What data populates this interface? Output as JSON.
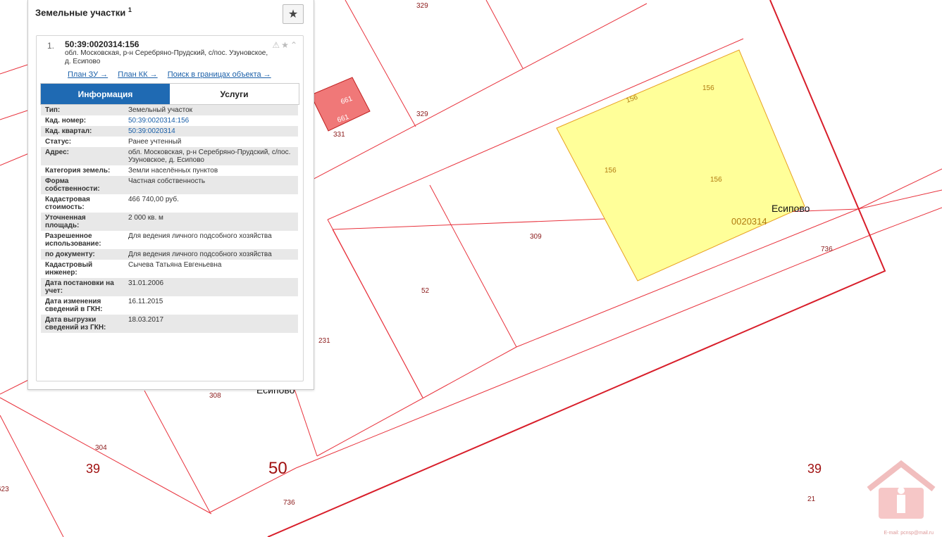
{
  "map": {
    "labels": {
      "l329a": "329",
      "l329b": "329",
      "l661a": "661",
      "l661b": "661",
      "l331": "331",
      "l156a": "156",
      "l156b": "156",
      "l156c": "156",
      "l156d": "156",
      "l309": "309",
      "l52": "52",
      "l231": "231",
      "l308": "308",
      "l304": "304",
      "l736a": "736",
      "l736b": "736",
      "l21": "21",
      "l623": "623",
      "l39a": "39",
      "l39b": "39",
      "l50": "50",
      "quarter": "0020314",
      "village": "Есипово",
      "village_cut": "Есипово"
    },
    "colors": {
      "boundary": "#e8323c",
      "major_boundary": "#d81e2a",
      "selected_fill": "#ffff99",
      "selected_stroke": "#e8a020",
      "highlight_fill": "#f07878"
    }
  },
  "panel": {
    "title": "Земельные участки",
    "count": "1",
    "item": {
      "number": "1.",
      "cadastral": "50:39:0020314:156",
      "address": "обл. Московская, р-н Серебряно-Прудский, с/пос. Узуновское, д. Есипово"
    },
    "links": [
      "План ЗУ →",
      "План КК →",
      "Поиск в границах объекта →"
    ],
    "tabs": {
      "info": "Информация",
      "services": "Услуги"
    },
    "rows": [
      {
        "k": "Тип:",
        "v": "Земельный участок"
      },
      {
        "k": "Кад. номер:",
        "v": "50:39:0020314:156"
      },
      {
        "k": "Кад. квартал:",
        "v": "50:39:0020314"
      },
      {
        "k": "Статус:",
        "v": "Ранее учтенный"
      },
      {
        "k": "Адрес:",
        "v": "обл. Московская, р-н Серебряно-Прудский, с/пос. Узуновское, д. Есипово"
      },
      {
        "k": "Категория земель:",
        "v": "Земли населённых пунктов"
      },
      {
        "k": "Форма собственности:",
        "v": "Частная собственность"
      },
      {
        "k": "Кадастровая стоимость:",
        "v": "466 740,00 руб."
      },
      {
        "k": "Уточненная площадь:",
        "v": "2 000 кв. м"
      },
      {
        "k": "Разрешенное использование:",
        "v": "Для ведения личного подсобного хозяйства"
      },
      {
        "k": "по документу:",
        "v": "Для ведения личного подсобного хозяйства"
      },
      {
        "k": "Кадастровый инженер:",
        "v": "Сычева Татьяна Евгеньевна"
      },
      {
        "k": "Дата постановки на учет:",
        "v": "31.01.2006"
      },
      {
        "k": "Дата изменения сведений в ГКН:",
        "v": "16.11.2015"
      },
      {
        "k": "Дата выгрузки сведений из ГКН:",
        "v": "18.03.2017"
      }
    ]
  },
  "watermark": {
    "email": "E-mail: pcnsp@mail.ru"
  }
}
